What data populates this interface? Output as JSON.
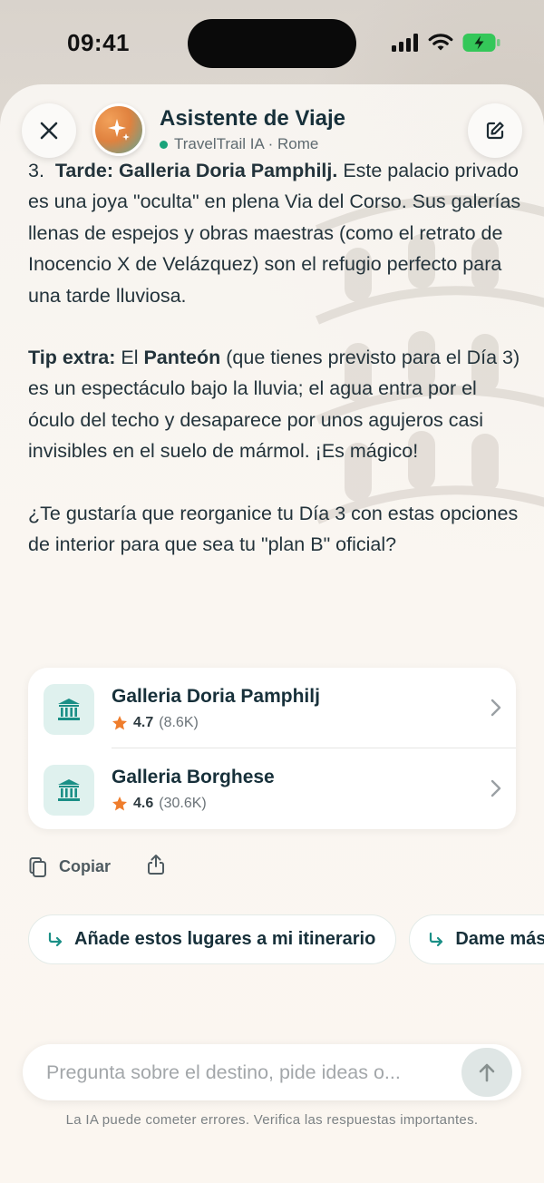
{
  "status_bar": {
    "time": "09:41"
  },
  "header": {
    "title": "Asistente de Viaje",
    "subtitle": "TravelTrail IA · Rome"
  },
  "message": {
    "item3": {
      "number": "3.",
      "heading": "Tarde: Galleria Doria Pamphilj.",
      "text": " Este palacio privado es una joya \"oculta\" en plena Via del Corso. Sus galerías llenas de espejos y obras maestras (como el retrato de Inocencio X de Velázquez) son el refugio perfecto para una tarde lluviosa."
    },
    "tip": {
      "label": "Tip extra:",
      "pre": " El ",
      "place": "Panteón",
      "text": " (que tienes previsto para el Día 3) es un espectáculo bajo la lluvia; el agua entra por el óculo del techo y desaparece por unos agujeros casi invisibles en el suelo de mármol. ¡Es mágico!"
    },
    "question": "¿Te gustaría que reorganice tu Día 3 con estas opciones de interior para que sea tu \"plan B\" oficial?"
  },
  "places": [
    {
      "name": "Galleria Doria Pamphilj",
      "rating": "4.7",
      "reviews": "(8.6K)",
      "icon": "museum-icon"
    },
    {
      "name": "Galleria Borghese",
      "rating": "4.6",
      "reviews": "(30.6K)",
      "icon": "museum-icon"
    }
  ],
  "actions": {
    "copy_label": "Copiar"
  },
  "suggestions": [
    {
      "label": "Añade estos lugares a mi itinerario"
    },
    {
      "label": "Dame más"
    }
  ],
  "input": {
    "placeholder": "Pregunta sobre el destino, pide ideas o..."
  },
  "disclaimer": "La IA puede cometer errores. Verifica las respuestas importantes.",
  "colors": {
    "accent": "#1a8f86",
    "star": "#ef7d2c",
    "online": "#1aa37a",
    "battery": "#34c759"
  }
}
